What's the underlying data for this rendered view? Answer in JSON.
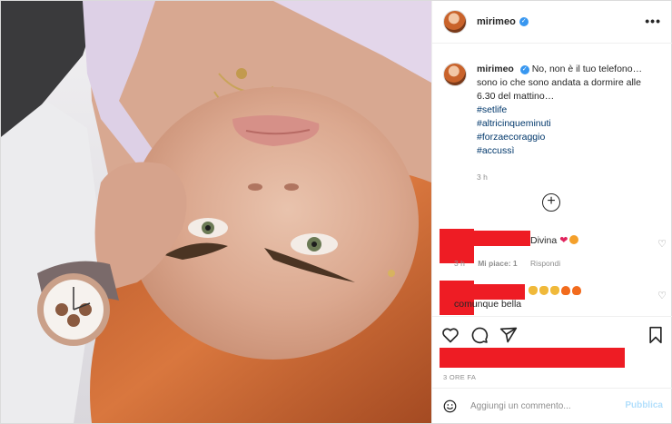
{
  "header": {
    "username": "mirimeo",
    "verified_icon": "verified-badge-icon",
    "more_icon": "more-options-icon"
  },
  "caption": {
    "username": "mirimeo",
    "text": "No, non è il tuo telefono… sono io che sono andata a dormire alle 6.30 del mattino…",
    "hashtags": [
      "#setlife",
      "#altricinqueminuti",
      "#forzaecoraggio",
      "#accussì"
    ],
    "time": "3 h"
  },
  "load_more_icon": "plus-circle-icon",
  "comments": [
    {
      "text": "Divina",
      "emojis": [
        "heart",
        "heart-eyes"
      ],
      "time": "3 h",
      "likes": "Mi piace: 1",
      "reply": "Rispondi"
    },
    {
      "text": "comunque bella",
      "emojis": [
        "clap",
        "clap",
        "clap",
        "fire",
        "fire"
      ]
    }
  ],
  "actions": {
    "like_icon": "heart-outline-icon",
    "comment_icon": "comment-icon",
    "share_icon": "share-icon",
    "save_icon": "bookmark-icon"
  },
  "post_age": "3 ORE FA",
  "add_comment": {
    "placeholder": "Aggiungi un commento...",
    "publish": "Pubblica"
  },
  "colors": {
    "redaction": "#ee1c24",
    "link": "#00376b",
    "publish_disabled": "#b2dffc",
    "verified": "#3897f0"
  }
}
